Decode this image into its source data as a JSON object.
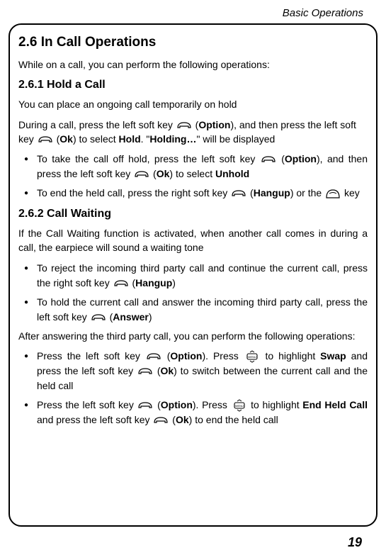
{
  "header": {
    "title": "Basic Operations"
  },
  "section": {
    "heading": "2.6 In Call Operations",
    "intro": "While on a call, you can perform the following operations:",
    "sub1": {
      "heading": "2.6.1 Hold a Call",
      "p1": "You can place an ongoing call temporarily on hold",
      "p2_a": "During a call, press the left soft key ",
      "p2_b": " (",
      "p2_option": "Option",
      "p2_c": "), and then press the left soft key ",
      "p2_d": " (",
      "p2_ok": "Ok",
      "p2_e": ") to select ",
      "p2_hold": "Hold",
      "p2_f": ". \"",
      "p2_holding": "Holding…",
      "p2_g": "\" will be displayed",
      "li1_a": "To take the call off hold, press the left soft key ",
      "li1_b": " (",
      "li1_option": "Option",
      "li1_c": "), and then press the left soft key ",
      "li1_d": " (",
      "li1_ok": "Ok",
      "li1_e": ") to select ",
      "li1_unhold": "Unhold",
      "li2_a": "To end the held call, press the right soft key ",
      "li2_b": " (",
      "li2_hangup": "Hangup",
      "li2_c": ") or the ",
      "li2_d": " key"
    },
    "sub2": {
      "heading": "2.6.2 Call Waiting",
      "p1": "If the Call Waiting function is activated, when another call comes in during a call, the earpiece will sound a waiting tone",
      "li1_a": "To reject the incoming third party call and continue the current call, press the right soft key  ",
      "li1_b": " (",
      "li1_hangup": "Hangup",
      "li1_c": ")",
      "li2_a": "To hold the current call and answer the incoming third party call, press the left soft key ",
      "li2_b": " (",
      "li2_answer": "Answer",
      "li2_c": ")",
      "p2": "After answering the third party call, you can perform the following operations:",
      "li3_a": "Press the left soft key ",
      "li3_b": " (",
      "li3_option": "Option",
      "li3_c": "). Press ",
      "li3_d": " to highlight ",
      "li3_swap": "Swap",
      "li3_e": " and press the left soft key ",
      "li3_f": " (",
      "li3_ok": "Ok",
      "li3_g": ") to switch between the current call and the held call",
      "li4_a": "Press the left soft key ",
      "li4_b": " (",
      "li4_option": "Option",
      "li4_c": "). Press ",
      "li4_d": " to highlight ",
      "li4_endheld": "End Held Call",
      "li4_e": " and press the left soft key ",
      "li4_f": " (",
      "li4_ok": "Ok",
      "li4_g": ") to end the held call"
    }
  },
  "page": {
    "number": "19"
  }
}
